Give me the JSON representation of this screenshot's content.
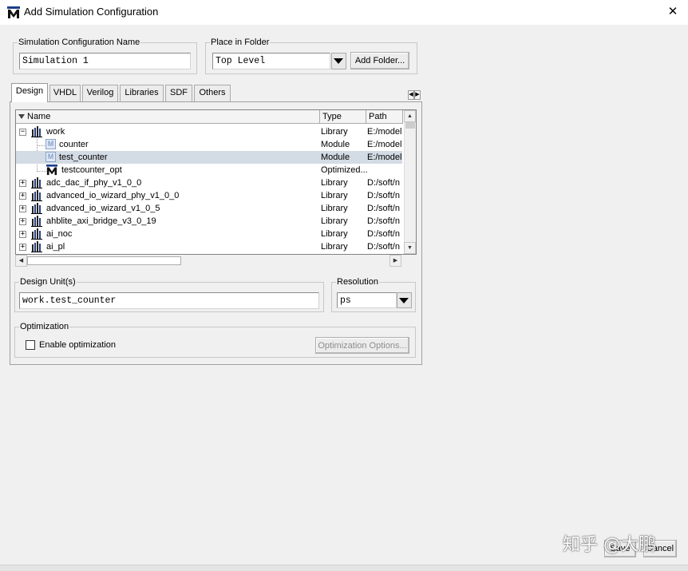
{
  "window": {
    "title": "Add Simulation Configuration",
    "close_symbol": "✕"
  },
  "config_name": {
    "label": "Simulation Configuration Name",
    "value": "Simulation 1"
  },
  "folder": {
    "label": "Place in Folder",
    "value": "Top Level",
    "add_button": "Add Folder..."
  },
  "tabs": [
    {
      "label": "Design",
      "active": true
    },
    {
      "label": "VHDL"
    },
    {
      "label": "Verilog"
    },
    {
      "label": "Libraries"
    },
    {
      "label": "SDF"
    },
    {
      "label": "Others"
    }
  ],
  "tree": {
    "columns": [
      "Name",
      "Type",
      "Path"
    ],
    "rows": [
      {
        "name": "work",
        "type": "Library",
        "path": "E:/model",
        "icon": "library-icon",
        "expander": "−"
      },
      {
        "name": "counter",
        "type": "Module",
        "path": "E:/model",
        "icon": "module-icon"
      },
      {
        "name": "test_counter",
        "type": "Module",
        "path": "E:/model",
        "icon": "module-icon",
        "selected": true
      },
      {
        "name": "testcounter_opt",
        "type": "Optimized...",
        "path": "",
        "icon": "optimized-design-icon"
      },
      {
        "name": "adc_dac_if_phy_v1_0_0",
        "type": "Library",
        "path": "D:/soft/n",
        "icon": "library-icon",
        "expander": "+"
      },
      {
        "name": "advanced_io_wizard_phy_v1_0_0",
        "type": "Library",
        "path": "D:/soft/n",
        "icon": "library-icon",
        "expander": "+"
      },
      {
        "name": "advanced_io_wizard_v1_0_5",
        "type": "Library",
        "path": "D:/soft/n",
        "icon": "library-icon",
        "expander": "+"
      },
      {
        "name": "ahblite_axi_bridge_v3_0_19",
        "type": "Library",
        "path": "D:/soft/n",
        "icon": "library-icon",
        "expander": "+"
      },
      {
        "name": "ai_noc",
        "type": "Library",
        "path": "D:/soft/n",
        "icon": "library-icon",
        "expander": "+"
      },
      {
        "name": "ai_pl",
        "type": "Library",
        "path": "D:/soft/n",
        "icon": "library-icon",
        "expander": "+"
      }
    ]
  },
  "design_units": {
    "label": "Design Unit(s)",
    "value": "work.test_counter"
  },
  "resolution": {
    "label": "Resolution",
    "value": "ps"
  },
  "optimization": {
    "label": "Optimization",
    "checkbox_label": "Enable optimization",
    "checked": false,
    "options_button": "Optimization Options..."
  },
  "footer": {
    "save": "Save",
    "cancel": "Cancel",
    "watermark": "知乎 @大鹏"
  },
  "colors": {
    "selection": "#d3dbe4",
    "brand": "#1b3f8b"
  }
}
